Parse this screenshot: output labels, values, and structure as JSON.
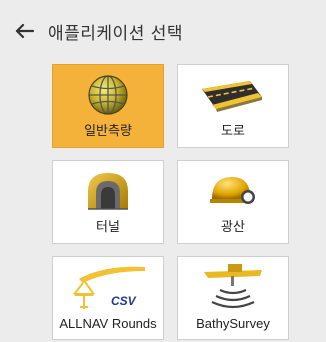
{
  "header": {
    "title": "애플리케이션 선택"
  },
  "colors": {
    "selected_tile": "#f4b23a",
    "tile_background": "#ffffff",
    "page_background": "#ececec",
    "csv_text": "#1f3a93"
  },
  "applications": [
    {
      "label": "일반측량",
      "icon": "globe-survey-icon",
      "selected": true
    },
    {
      "label": "도로",
      "icon": "road-icon",
      "selected": false
    },
    {
      "label": "터널",
      "icon": "tunnel-icon",
      "selected": false
    },
    {
      "label": "광산",
      "icon": "mining-helmet-icon",
      "selected": false
    },
    {
      "label": "ALLNAV Rounds",
      "icon": "allnav-rounds-icon",
      "icon_text": "CSV",
      "selected": false
    },
    {
      "label": "BathySurvey",
      "icon": "bathy-survey-icon",
      "selected": false
    }
  ]
}
